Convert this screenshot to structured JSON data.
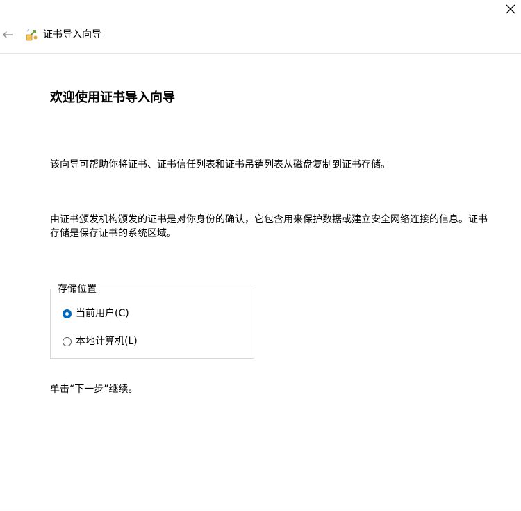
{
  "window": {
    "close_icon": "close-icon",
    "back_icon": "back-arrow-icon",
    "wizard_icon": "certificate-wizard-icon",
    "title": "证书导入向导"
  },
  "main": {
    "heading": "欢迎使用证书导入向导",
    "paragraph1": "该向导可帮助你将证书、证书信任列表和证书吊销列表从磁盘复制到证书存储。",
    "paragraph2": "由证书颁发机构颁发的证书是对你身份的确认，它包含用来保护数据或建立安全网络连接的信息。证书存储是保存证书的系统区域。",
    "store_location": {
      "legend": "存储位置",
      "options": [
        {
          "label": "当前用户(C)",
          "checked": true
        },
        {
          "label": "本地计算机(L)",
          "checked": false
        }
      ]
    },
    "continue_hint": "单击“下一步”继续。"
  },
  "colors": {
    "accent": "#0067c0",
    "divider": "#e3e3e3",
    "group_border": "#d6d6d6"
  }
}
